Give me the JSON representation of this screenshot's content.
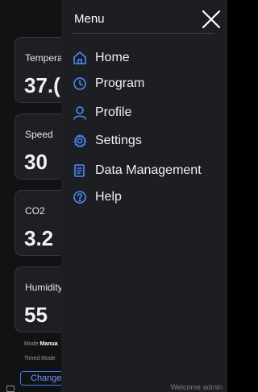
{
  "dashboard": {
    "cards": [
      {
        "label": "Tempera",
        "value": "37.("
      },
      {
        "label": "Speed",
        "value": "30"
      },
      {
        "label": "CO2",
        "value": "3.2"
      },
      {
        "label": "Humidity",
        "value": "55"
      }
    ],
    "mode_label": "Mode:",
    "mode_value": "Manua",
    "timed_mode_label": "Timed Mode",
    "change_button": "Change"
  },
  "menu": {
    "title": "Menu",
    "items": [
      {
        "label": "Home",
        "icon": "home-icon"
      },
      {
        "label": "Program",
        "icon": "clock-icon"
      },
      {
        "label": "Profile",
        "icon": "user-icon"
      },
      {
        "label": "Settings",
        "icon": "gear-icon"
      },
      {
        "label": "Data Management",
        "icon": "document-icon"
      },
      {
        "label": "Help",
        "icon": "help-icon"
      }
    ],
    "welcome": "Welcome admin"
  },
  "colors": {
    "accent": "#4a8cff",
    "menu_bg": "#1d1e21",
    "card_bg": "#1d1f22"
  }
}
